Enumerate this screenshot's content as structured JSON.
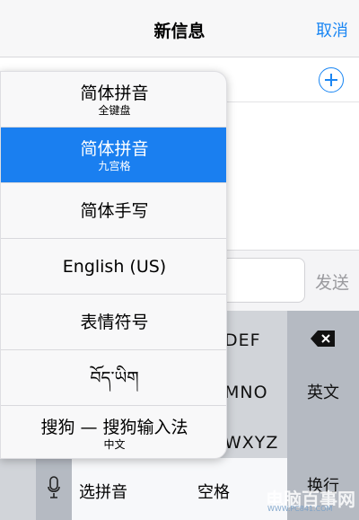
{
  "nav": {
    "title": "新信息",
    "cancel": "取消"
  },
  "compose": {
    "send": "发送"
  },
  "keyboard": {
    "rows": [
      "DEF",
      "MNO",
      "WXYZ"
    ],
    "right_keys": {
      "switch_lang": "英文",
      "return": "换行"
    },
    "bottom": {
      "pinyin": "选拼音",
      "space": "空格"
    }
  },
  "input_methods": [
    {
      "name": "简体拼音",
      "sub": "全键盘",
      "selected": false
    },
    {
      "name": "简体拼音",
      "sub": "九宫格",
      "selected": true
    },
    {
      "name": "简体手写",
      "sub": "",
      "selected": false
    },
    {
      "name": "English (US)",
      "sub": "",
      "selected": false
    },
    {
      "name": "表情符号",
      "sub": "",
      "selected": false
    },
    {
      "name": "བོད་ཡིག",
      "sub": "",
      "selected": false
    },
    {
      "name": "搜狗 — 搜狗输入法",
      "sub": "中文",
      "selected": false
    }
  ],
  "watermark": {
    "main": "电脑百事网",
    "sub": "WWW.PC841.COM"
  },
  "colors": {
    "accent": "#1a86f3",
    "selected": "#1a7ff0"
  },
  "icons": {
    "add": "plus-circle-icon",
    "delete": "backspace-icon",
    "mic": "microphone-icon"
  }
}
